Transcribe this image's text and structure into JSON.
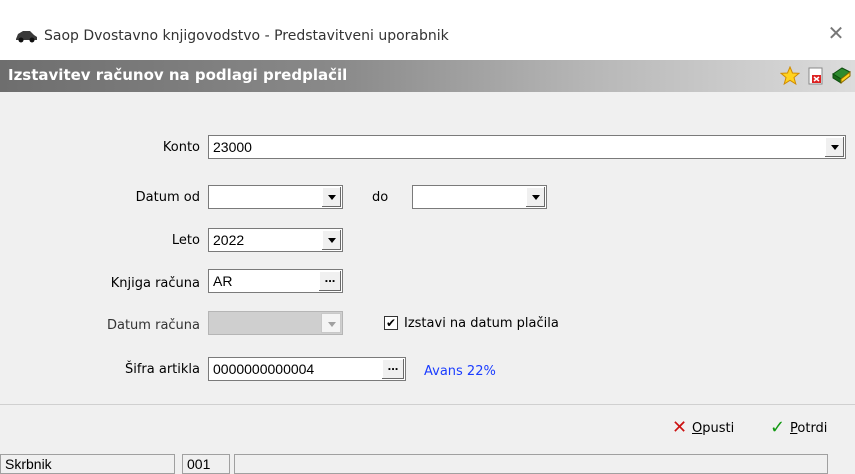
{
  "window": {
    "title": "Saop Dvostavno knjigovodstvo - Predstavitveni uporabnik",
    "close_glyph": "✕"
  },
  "header": {
    "title": "Izstavitev računov na podlagi predplačil",
    "icons": [
      "star-icon",
      "pdf-icon",
      "book-icon"
    ]
  },
  "form": {
    "konto": {
      "label": "Konto",
      "value": "23000"
    },
    "datum_od": {
      "label": "Datum od",
      "value": ""
    },
    "datum_do": {
      "label": "do",
      "value": ""
    },
    "leto": {
      "label": "Leto",
      "value": "2022"
    },
    "knjiga": {
      "label": "Knjiga računa",
      "value": "AR",
      "browse": "..."
    },
    "datum_racuna": {
      "label": "Datum računa",
      "value": ""
    },
    "izstavi": {
      "label": "Izstavi na datum plačila",
      "checked": true,
      "mark": "✔"
    },
    "sifra": {
      "label": "Šifra artikla",
      "value": "0000000000004",
      "browse": "...",
      "desc": "Avans 22%"
    }
  },
  "buttons": {
    "cancel": {
      "first": "O",
      "rest": "pusti",
      "icon": "✕"
    },
    "confirm": {
      "first": "P",
      "rest": "otrdi",
      "icon": "✓"
    }
  },
  "status": {
    "user": "Skrbnik",
    "code": "001",
    "extra": ""
  },
  "colors": {
    "link": "#1a3cff",
    "cancel_icon": "#cc1111",
    "confirm_icon": "#119911"
  }
}
